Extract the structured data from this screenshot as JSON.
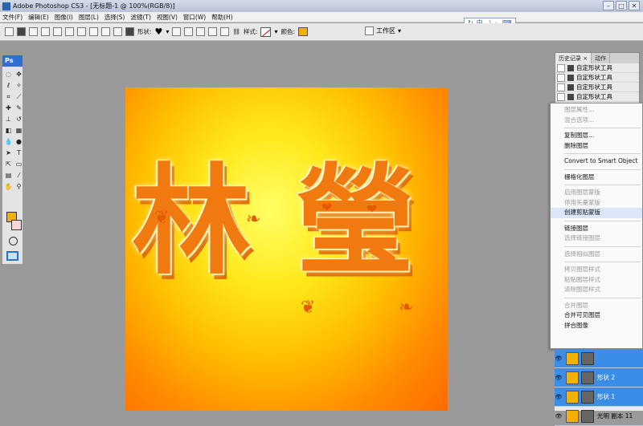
{
  "window": {
    "title": "Adobe Photoshop CS3 - [无标题-1 @ 100%(RGB/8)]"
  },
  "menubar": [
    "文件(F)",
    "编辑(E)",
    "图像(I)",
    "图层(L)",
    "选择(S)",
    "滤镜(T)",
    "视图(V)",
    "窗口(W)",
    "帮助(H)"
  ],
  "ime": {
    "label": "中"
  },
  "options": {
    "shape_label": "形状:",
    "style_label": "样式:",
    "color_label": "颜色:",
    "color_value": "#f2b100",
    "workspace_label": "工作区"
  },
  "toolbox": {
    "logo": "Ps",
    "fg_color": "#f2b100",
    "bg_color": "#f8d6d6"
  },
  "canvas": {
    "text_glyphs": [
      "林",
      "瑩"
    ],
    "gradient_colors": [
      "#ffff66",
      "#ffc000",
      "#ff6a00"
    ]
  },
  "history": {
    "tabs": [
      "历史记录 ×",
      "动作"
    ],
    "items": [
      "自定形状工具",
      "自定形状工具",
      "自定形状工具",
      "自定形状工具"
    ]
  },
  "context_menu": {
    "groups": [
      [
        {
          "label": "图层属性...",
          "enabled": false
        },
        {
          "label": "混合选项...",
          "enabled": false
        }
      ],
      [
        {
          "label": "复制图层...",
          "enabled": true
        },
        {
          "label": "删除图层",
          "enabled": true
        }
      ],
      [
        {
          "label": "Convert to Smart Object",
          "enabled": true
        }
      ],
      [
        {
          "label": "栅格化图层",
          "enabled": true
        }
      ],
      [
        {
          "label": "启用图层蒙版",
          "enabled": false
        },
        {
          "label": "停用矢量蒙版",
          "enabled": false
        },
        {
          "label": "创建剪贴蒙版",
          "enabled": true,
          "highlighted": true
        }
      ],
      [
        {
          "label": "链接图层",
          "enabled": true
        },
        {
          "label": "选择链接图层",
          "enabled": false
        }
      ],
      [
        {
          "label": "选择相似图层",
          "enabled": false
        }
      ],
      [
        {
          "label": "拷贝图层样式",
          "enabled": false
        },
        {
          "label": "粘贴图层样式",
          "enabled": false
        },
        {
          "label": "清除图层样式",
          "enabled": false
        }
      ],
      [
        {
          "label": "合并图层",
          "enabled": false
        },
        {
          "label": "合并可见图层",
          "enabled": true
        },
        {
          "label": "拼合图像",
          "enabled": true
        }
      ]
    ]
  },
  "layers": [
    {
      "name": "",
      "selected": true
    },
    {
      "name": "形状 2",
      "selected": true
    },
    {
      "name": "形状 1",
      "selected": true
    },
    {
      "name": "光明 副本 11",
      "selected": false
    }
  ]
}
